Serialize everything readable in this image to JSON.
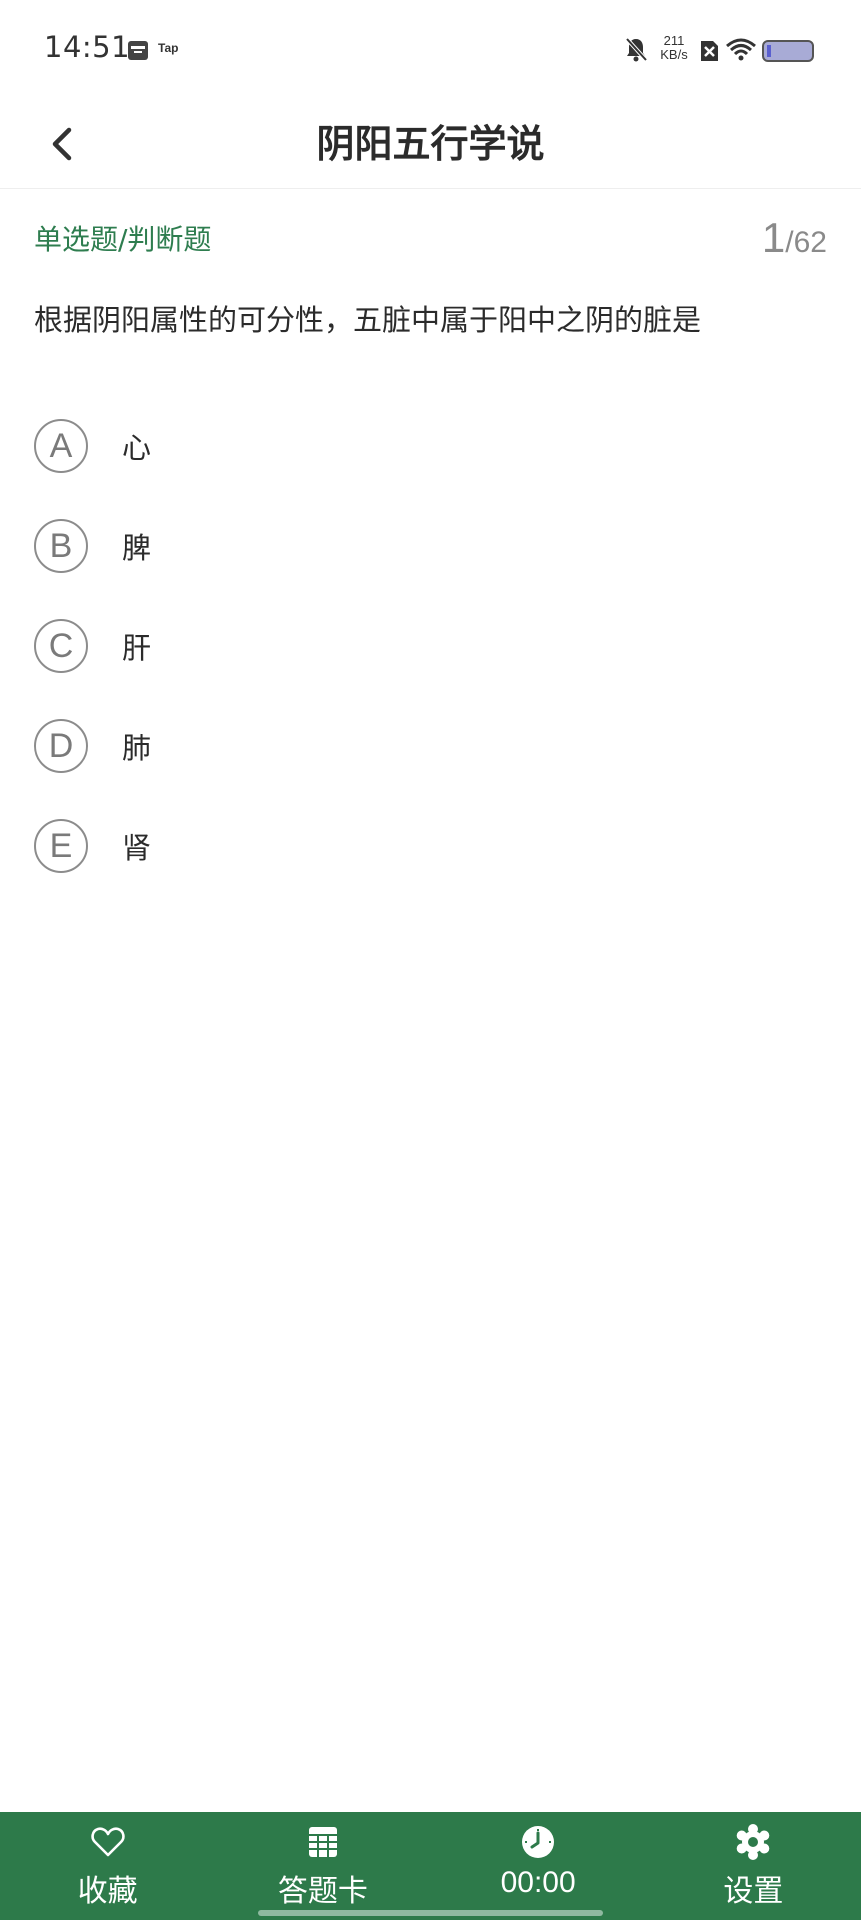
{
  "status_bar": {
    "time": "14:51",
    "tap_label": "Tap",
    "speed_value": "211",
    "speed_unit": "KB/s"
  },
  "header": {
    "title": "阴阳五行学说",
    "back_icon": "chevron-left-icon"
  },
  "question": {
    "type_label": "单选题/判断题",
    "current": "1",
    "total": "/62",
    "text": "根据阴阳属性的可分性，五脏中属于阳中之阴的脏是",
    "options": [
      {
        "letter": "A",
        "text": "心"
      },
      {
        "letter": "B",
        "text": "脾"
      },
      {
        "letter": "C",
        "text": "肝"
      },
      {
        "letter": "D",
        "text": "肺"
      },
      {
        "letter": "E",
        "text": "肾"
      }
    ]
  },
  "bottom_bar": {
    "favorite": {
      "label": "收藏",
      "icon": "heart-icon"
    },
    "answer_card": {
      "label": "答题卡",
      "icon": "grid-icon"
    },
    "timer": {
      "label": "00:00",
      "icon": "clock-icon"
    },
    "settings": {
      "label": "设置",
      "icon": "gear-icon"
    }
  },
  "colors": {
    "accent": "#2d7a4a",
    "type_label": "#2e7d4f",
    "option_border": "#8c8c8c"
  }
}
